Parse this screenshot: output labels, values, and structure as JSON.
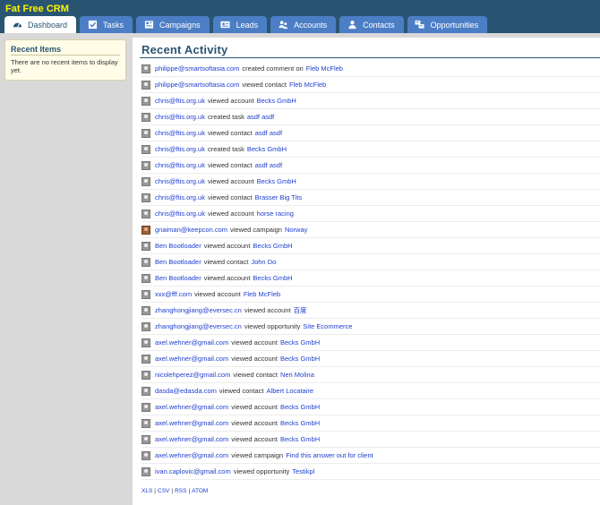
{
  "app": {
    "title": "Fat Free CRM"
  },
  "tabs": [
    {
      "label": "Dashboard",
      "icon": "dashboard-icon"
    },
    {
      "label": "Tasks",
      "icon": "tasks-icon"
    },
    {
      "label": "Campaigns",
      "icon": "campaigns-icon"
    },
    {
      "label": "Leads",
      "icon": "leads-icon"
    },
    {
      "label": "Accounts",
      "icon": "accounts-icon"
    },
    {
      "label": "Contacts",
      "icon": "contacts-icon"
    },
    {
      "label": "Opportunities",
      "icon": "opportunities-icon"
    }
  ],
  "sidebar": {
    "title": "Recent Items",
    "empty_text": "There are no recent items to display yet."
  },
  "main": {
    "title": "Recent Activity",
    "activities": [
      {
        "user": "philippe@smartsoftasia.com",
        "action": "created comment on",
        "target": "Fleb McFleb"
      },
      {
        "user": "philippe@smartsoftasia.com",
        "action": "viewed contact",
        "target": "Fleb McFleb"
      },
      {
        "user": "chris@ftis.org.uk",
        "action": "viewed account",
        "target": "Becks GmbH"
      },
      {
        "user": "chris@ftis.org.uk",
        "action": "created task",
        "target": "asdf asdf"
      },
      {
        "user": "chris@ftis.org.uk",
        "action": "viewed contact",
        "target": "asdf asdf"
      },
      {
        "user": "chris@ftis.org.uk",
        "action": "created task",
        "target": "Becks GmbH"
      },
      {
        "user": "chris@ftis.org.uk",
        "action": "viewed contact",
        "target": "asdf asdf"
      },
      {
        "user": "chris@ftis.org.uk",
        "action": "viewed account",
        "target": "Becks GmbH"
      },
      {
        "user": "chris@ftis.org.uk",
        "action": "viewed contact",
        "target": "Brasser Big Tits"
      },
      {
        "user": "chris@ftis.org.uk",
        "action": "viewed account",
        "target": "horse racing"
      },
      {
        "user": "gnaiman@keepcon.com",
        "action": "viewed campaign",
        "target": "Norway"
      },
      {
        "user": "Ben Bootloader",
        "action": "viewed account",
        "target": "Becks GmbH"
      },
      {
        "user": "Ben Bootloader",
        "action": "viewed contact",
        "target": "John Do"
      },
      {
        "user": "Ben Bootloader",
        "action": "viewed account",
        "target": "Becks GmbH"
      },
      {
        "user": "xxx@fff.com",
        "action": "viewed account",
        "target": "Fleb McFleb"
      },
      {
        "user": "zhanghongjiang@eversec.cn",
        "action": "viewed account",
        "target": "百度"
      },
      {
        "user": "zhanghongjiang@eversec.cn",
        "action": "viewed opportunity",
        "target": "Site Ecommerce"
      },
      {
        "user": "axel.wehner@gmail.com",
        "action": "viewed account",
        "target": "Becks GmbH"
      },
      {
        "user": "axel.wehner@gmail.com",
        "action": "viewed account",
        "target": "Becks GmbH"
      },
      {
        "user": "nicolehperez@gmail.com",
        "action": "viewed contact",
        "target": "Neri Molina"
      },
      {
        "user": "dasda@edasda.com",
        "action": "viewed contact",
        "target": "Albert Locataire"
      },
      {
        "user": "axel.wehner@gmail.com",
        "action": "viewed account",
        "target": "Becks GmbH"
      },
      {
        "user": "axel.wehner@gmail.com",
        "action": "viewed account",
        "target": "Becks GmbH"
      },
      {
        "user": "axel.wehner@gmail.com",
        "action": "viewed account",
        "target": "Becks GmbH"
      },
      {
        "user": "axel.wehner@gmail.com",
        "action": "viewed campaign",
        "target": "Find this answer out for client"
      },
      {
        "user": "ivan.caplovic@gmail.com",
        "action": "viewed opportunity",
        "target": "Testikpl"
      }
    ],
    "exports": [
      "XLS",
      "CSV",
      "RSS",
      "ATOM"
    ]
  }
}
